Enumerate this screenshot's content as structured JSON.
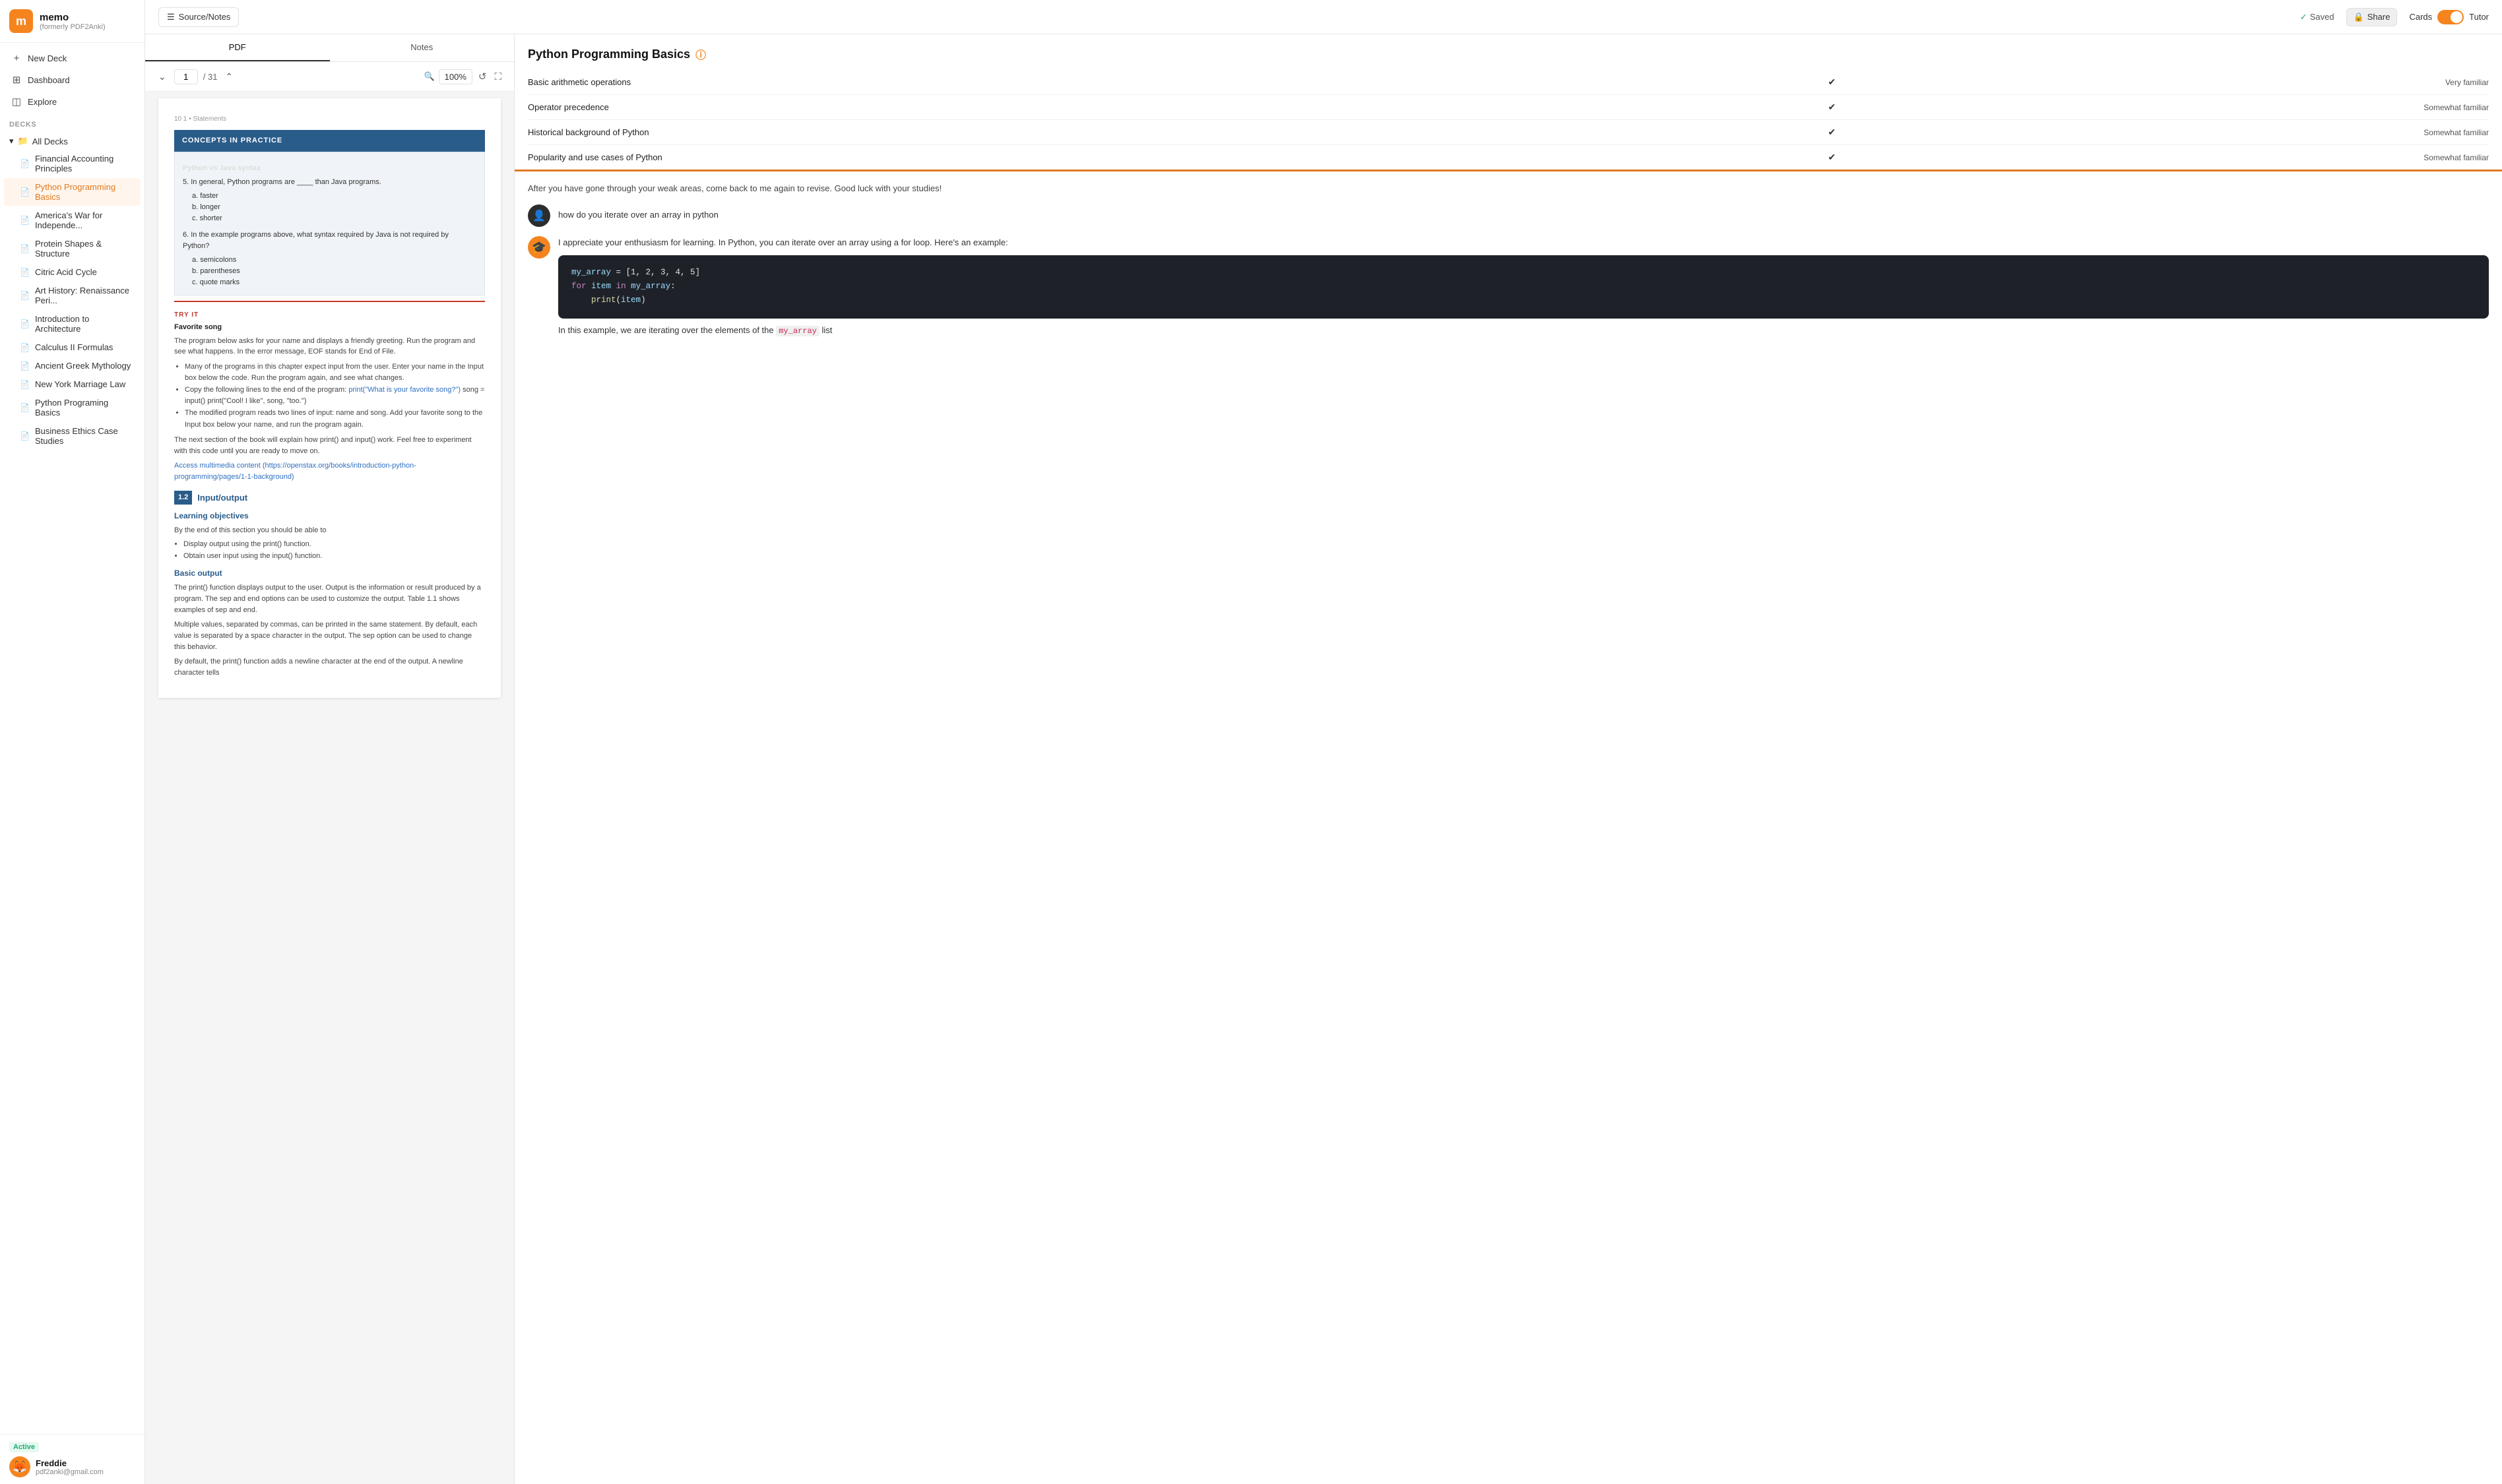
{
  "app": {
    "name": "memo",
    "subtitle": "(formerly PDF2Anki)",
    "saved": "Saved",
    "share": "Share",
    "cards": "Cards",
    "tutor": "Tutor"
  },
  "topbar": {
    "source_notes": "Source/Notes"
  },
  "sidebar": {
    "nav": [
      {
        "id": "new-deck",
        "label": "New Deck",
        "icon": "+"
      },
      {
        "id": "dashboard",
        "label": "Dashboard",
        "icon": "⊞"
      },
      {
        "id": "explore",
        "label": "Explore",
        "icon": "◫"
      }
    ],
    "decks_label": "Decks",
    "all_decks": "All Decks",
    "decks": [
      {
        "id": "financial",
        "label": "Financial Accounting Principles"
      },
      {
        "id": "python",
        "label": "Python Programming Basics",
        "active": true
      },
      {
        "id": "america",
        "label": "America's War for Independe..."
      },
      {
        "id": "protein",
        "label": "Protein Shapes & Structure"
      },
      {
        "id": "citric",
        "label": "Citric Acid Cycle"
      },
      {
        "id": "art",
        "label": "Art History: Renaissance Peri..."
      },
      {
        "id": "architecture",
        "label": "Introduction to Architecture"
      },
      {
        "id": "calculus",
        "label": "Calculus II Formulas"
      },
      {
        "id": "greek",
        "label": "Ancient Greek Mythology"
      },
      {
        "id": "marriage",
        "label": "New York Marriage Law"
      },
      {
        "id": "python2",
        "label": "Python Programing Basics"
      },
      {
        "id": "business",
        "label": "Business Ethics Case Studies"
      }
    ],
    "active_label": "Active",
    "user": {
      "name": "Freddie",
      "email": "pdf2anki@gmail.com"
    }
  },
  "pdf": {
    "tab_pdf": "PDF",
    "tab_notes": "Notes",
    "page": "1",
    "total": "/ 31",
    "zoom": "100%",
    "page_num_label": "10  1 • Statements",
    "concepts_title": "CONCEPTS IN PRACTICE",
    "concepts_subtitle": "Python vs Java syntax",
    "q5": "5.  In general, Python programs are ____ than Java programs.",
    "q5_a": "a.  faster",
    "q5_b": "b.  longer",
    "q5_c": "c.  shorter",
    "q6": "6.  In the example programs above, what syntax required by Java is not required by Python?",
    "q6_a": "a.  semicolons",
    "q6_b": "b.  parentheses",
    "q6_c": "c.  quote marks",
    "try_label": "TRY IT",
    "try_title": "Favorite song",
    "try_intro": "The program below asks for your name and displays a friendly greeting. Run the program and see what happens. In the error message, EOF stands for End of File.",
    "try_b1": "Many of the programs in this chapter expect input from the user. Enter your name in the Input box below the code. Run the program again, and see what changes.",
    "try_b2": "Copy the following lines to the end of the program: print(\"What is your favorite song?\") song = input() print(\"Cool! I like\", song, \"too.\")",
    "try_b3": "The modified program reads two lines of input: name and song. Add your favorite song to the Input box below your name, and run the program again.",
    "try_p": "The next section of the book will explain how print() and input() work. Feel free to experiment with this code until you are ready to move on.",
    "link": "Access multimedia content (https://openstax.org/books/introduction-python-programming/pages/1-1-background)",
    "section_num": "1.2",
    "section_name": "Input/output",
    "learning_title": "Learning objectives",
    "learning_sub": "By the end of this section you should be able to",
    "learning_b1": "Display output using the print() function.",
    "learning_b2": "Obtain user input using the input() function.",
    "basic_output_title": "Basic output",
    "para1": "The print() function displays output to the user. Output is the information or result produced by a program. The sep and end options can be used to customize the output. Table 1.1 shows examples of sep and end.",
    "para2": "Multiple values, separated by commas, can be printed in the same statement. By default, each value is separated by a space character in the output. The sep option can be used to change this behavior.",
    "para3": "By default, the print() function adds a newline character at the end of the output. A newline character tells"
  },
  "tutor": {
    "title": "Python Programming Basics",
    "rows": [
      {
        "concept": "Basic arithmetic operations",
        "check": "✔",
        "level": "Very familiar"
      },
      {
        "concept": "Operator precedence",
        "check": "✔",
        "level": "Somewhat familiar"
      },
      {
        "concept": "Historical background of Python",
        "check": "✔",
        "level": "Somewhat familiar"
      },
      {
        "concept": "Popularity and use cases of Python",
        "check": "✔",
        "level": "Somewhat familiar"
      }
    ],
    "note": "After you have gone through your weak areas, come back to me again to revise. Good luck with your studies!",
    "user_msg": "how do you iterate over an array in python",
    "bot_msg1": "I appreciate your enthusiasm for learning. In Python, you can iterate over an array using a for loop. Here's an example:",
    "code": "my_array = [1, 2, 3, 4, 5]\nfor item in my_array:\n    print(item)",
    "bot_msg2": "In this example, we are iterating over the elements of the `my_array` list"
  }
}
